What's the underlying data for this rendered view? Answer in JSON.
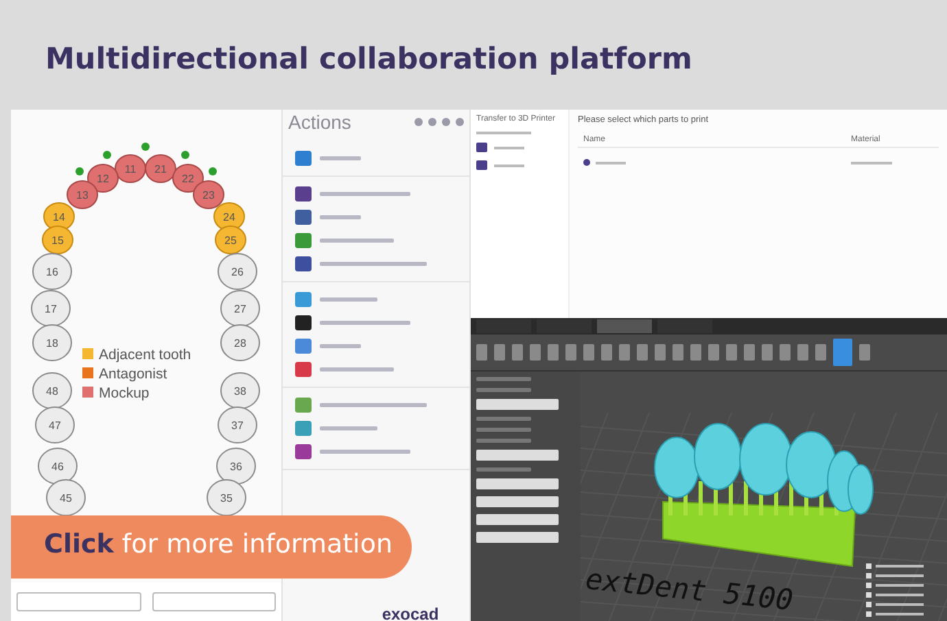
{
  "header": {
    "title": "Multidirectional collaboration platform"
  },
  "tooth_chart": {
    "teeth": [
      {
        "number": "11",
        "kind": "mockup"
      },
      {
        "number": "12",
        "kind": "mockup"
      },
      {
        "number": "13",
        "kind": "mockup"
      },
      {
        "number": "14",
        "kind": "adjacent"
      },
      {
        "number": "15",
        "kind": "adjacent"
      },
      {
        "number": "16",
        "kind": "normal"
      },
      {
        "number": "17",
        "kind": "normal"
      },
      {
        "number": "18",
        "kind": "normal"
      },
      {
        "number": "48",
        "kind": "normal"
      },
      {
        "number": "47",
        "kind": "normal"
      },
      {
        "number": "46",
        "kind": "normal"
      },
      {
        "number": "45",
        "kind": "normal"
      },
      {
        "number": "21",
        "kind": "mockup"
      },
      {
        "number": "22",
        "kind": "mockup"
      },
      {
        "number": "23",
        "kind": "mockup"
      },
      {
        "number": "24",
        "kind": "adjacent"
      },
      {
        "number": "25",
        "kind": "adjacent"
      },
      {
        "number": "26",
        "kind": "normal"
      },
      {
        "number": "27",
        "kind": "normal"
      },
      {
        "number": "28",
        "kind": "normal"
      },
      {
        "number": "38",
        "kind": "normal"
      },
      {
        "number": "37",
        "kind": "normal"
      },
      {
        "number": "36",
        "kind": "normal"
      },
      {
        "number": "35",
        "kind": "normal"
      }
    ],
    "legend": [
      {
        "label": "Adjacent tooth",
        "color": "#f5b731"
      },
      {
        "label": "Antagonist",
        "color": "#e8741e"
      },
      {
        "label": "Mockup",
        "color": "#e07070"
      }
    ]
  },
  "actions_panel": {
    "title": "Actions",
    "logo": "exocad",
    "groups": [
      {
        "items": [
          {
            "color": "#2f7fd0"
          }
        ]
      },
      {
        "items": [
          {
            "color": "#5a3f8f"
          },
          {
            "color": "#3f5f9f"
          },
          {
            "color": "#3a9a3a"
          },
          {
            "color": "#3f4fa0"
          }
        ]
      },
      {
        "items": [
          {
            "color": "#3a9ad8"
          },
          {
            "color": "#222222"
          },
          {
            "color": "#4a8ad8"
          },
          {
            "color": "#d83a4a"
          }
        ]
      },
      {
        "items": [
          {
            "color": "#6aa84f"
          },
          {
            "color": "#3aa0b8"
          },
          {
            "color": "#9a3a9a"
          }
        ]
      }
    ]
  },
  "print_panel": {
    "sidebar_title": "Transfer to 3D Printer",
    "prompt": "Please select which parts to print",
    "columns": [
      "Name",
      "Material"
    ]
  },
  "viewer": {
    "tabs": [
      {
        "selected": false
      },
      {
        "selected": false
      },
      {
        "selected": true
      },
      {
        "selected": false
      }
    ],
    "printer_label": "extDent 5100"
  },
  "cta": {
    "text": "**Click** for more information"
  }
}
